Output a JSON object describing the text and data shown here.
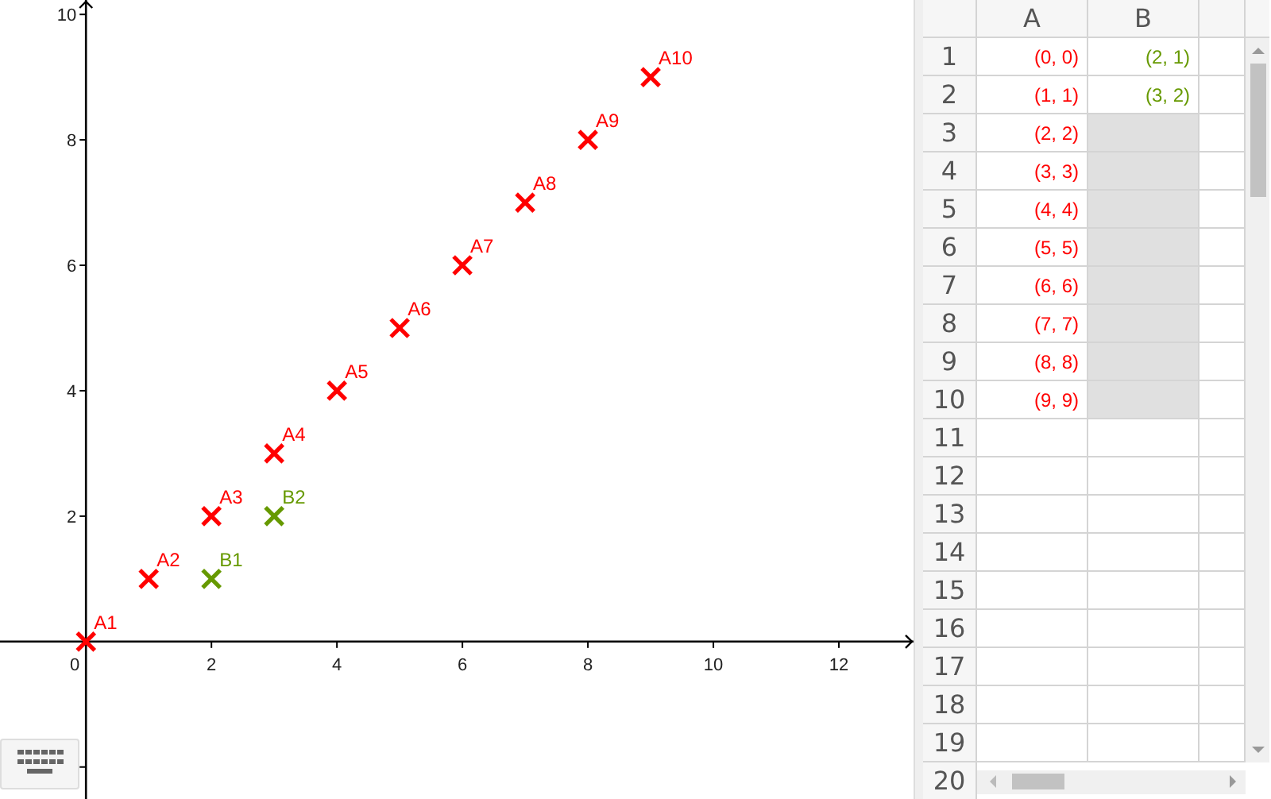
{
  "graphics": {
    "chart_data": {
      "type": "scatter",
      "xlim": [
        -1.37,
        13.19
      ],
      "ylim": [
        -2.51,
        10.23
      ],
      "xticks": [
        0,
        2,
        4,
        6,
        8,
        10,
        12
      ],
      "yticks": [
        2,
        4,
        6,
        8,
        10
      ],
      "series": [
        {
          "color": "#ff0000",
          "x": [
            0,
            1,
            2,
            3,
            4,
            5,
            6,
            7,
            8,
            9
          ],
          "values": [
            0,
            1,
            2,
            3,
            4,
            5,
            6,
            7,
            8,
            9
          ]
        },
        {
          "color": "#669900",
          "x": [
            2,
            3
          ],
          "values": [
            1,
            2
          ]
        }
      ],
      "annotations": [
        {
          "x": 0,
          "y": 0,
          "text": "A1"
        },
        {
          "x": 1,
          "y": 1,
          "text": "A2"
        },
        {
          "x": 2,
          "y": 2,
          "text": "A3"
        },
        {
          "x": 3,
          "y": 3,
          "text": "A4"
        },
        {
          "x": 4,
          "y": 4,
          "text": "A5"
        },
        {
          "x": 5,
          "y": 5,
          "text": "A6"
        },
        {
          "x": 6,
          "y": 6,
          "text": "A7"
        },
        {
          "x": 7,
          "y": 7,
          "text": "A8"
        },
        {
          "x": 8,
          "y": 8,
          "text": "A9"
        },
        {
          "x": 9,
          "y": 9,
          "text": "A10"
        },
        {
          "x": 2,
          "y": 1,
          "text": "B1"
        },
        {
          "x": 3,
          "y": 2,
          "text": "B2"
        }
      ]
    }
  },
  "spreadsheet": {
    "columns": [
      "A",
      "B"
    ],
    "rows": [
      {
        "header": "1",
        "cells": [
          {
            "text": "(0, 0)",
            "color": "#ff0000",
            "highlighted": false
          },
          {
            "text": "(2, 1)",
            "color": "#669900",
            "highlighted": false
          }
        ]
      },
      {
        "header": "2",
        "cells": [
          {
            "text": "(1, 1)",
            "color": "#ff0000",
            "highlighted": false
          },
          {
            "text": "(3, 2)",
            "color": "#669900",
            "highlighted": false
          }
        ]
      },
      {
        "header": "3",
        "cells": [
          {
            "text": "(2, 2)",
            "color": "#ff0000",
            "highlighted": false
          },
          {
            "highlighted": true
          }
        ]
      },
      {
        "header": "4",
        "cells": [
          {
            "text": "(3, 3)",
            "color": "#ff0000",
            "highlighted": false
          },
          {
            "highlighted": true
          }
        ]
      },
      {
        "header": "5",
        "cells": [
          {
            "text": "(4, 4)",
            "color": "#ff0000",
            "highlighted": false
          },
          {
            "highlighted": true
          }
        ]
      },
      {
        "header": "6",
        "cells": [
          {
            "text": "(5, 5)",
            "color": "#ff0000",
            "highlighted": false
          },
          {
            "highlighted": true
          }
        ]
      },
      {
        "header": "7",
        "cells": [
          {
            "text": "(6, 6)",
            "color": "#ff0000",
            "highlighted": false
          },
          {
            "highlighted": true
          }
        ]
      },
      {
        "header": "8",
        "cells": [
          {
            "text": "(7, 7)",
            "color": "#ff0000",
            "highlighted": false
          },
          {
            "highlighted": true
          }
        ]
      },
      {
        "header": "9",
        "cells": [
          {
            "text": "(8, 8)",
            "color": "#ff0000",
            "highlighted": false
          },
          {
            "highlighted": true
          }
        ]
      },
      {
        "header": "10",
        "cells": [
          {
            "text": "(9, 9)",
            "color": "#ff0000",
            "highlighted": false
          },
          {
            "highlighted": true
          }
        ]
      },
      {
        "header": "11"
      },
      {
        "header": "12"
      },
      {
        "header": "13"
      },
      {
        "header": "14"
      },
      {
        "header": "15"
      },
      {
        "header": "16"
      },
      {
        "header": "17"
      },
      {
        "header": "18"
      },
      {
        "header": "19"
      },
      {
        "header": "20"
      }
    ]
  }
}
